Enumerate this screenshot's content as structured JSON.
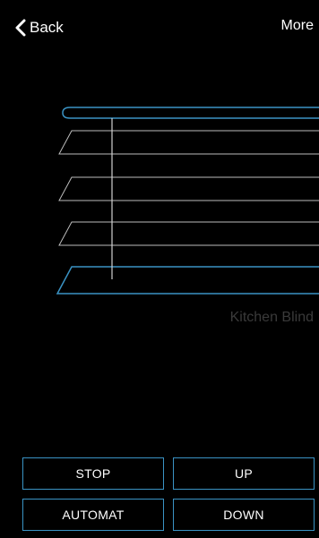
{
  "header": {
    "back_label": "Back",
    "more_label": "More"
  },
  "device": {
    "name": "Kitchen Blind"
  },
  "controls": {
    "stop_label": "STOP",
    "up_label": "UP",
    "automat_label": "AUTOMAT",
    "down_label": "DOWN"
  },
  "colors": {
    "accent": "#3a93c4",
    "slat": "#bdbdbd",
    "background": "#000000"
  },
  "icons": {
    "back": "chevron-left-icon"
  }
}
